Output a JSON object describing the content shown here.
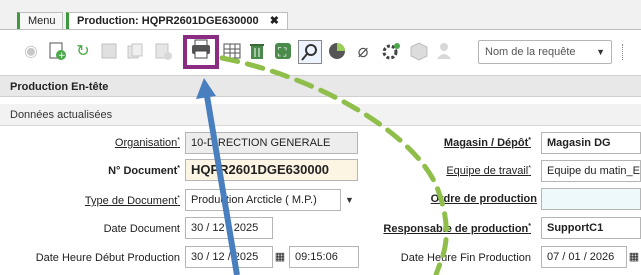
{
  "tabs": {
    "menu": "Menu",
    "active": "Production: HQPR2601DGE630000",
    "close": "✖"
  },
  "toolbar": {
    "request_placeholder": "Nom de la requête",
    "icons": [
      "refresh-icon",
      "new-record-icon",
      "undo-icon",
      "save-icon",
      "copy-icon",
      "delete-record-icon",
      "print-icon",
      "grid-icon",
      "trash-icon",
      "zoom-fit-icon",
      "search-zoom-icon",
      "chart-icon",
      "attachment-icon",
      "process-icon",
      "package-icon",
      "user-icon"
    ]
  },
  "section": {
    "title": "Production En-tête",
    "subtitle": "Données actualisées"
  },
  "form": {
    "organisation_label": "Organisation",
    "organisation_value": "10-DIRECTION GENERALE",
    "doc_label": "N° Document",
    "doc_value": "HQPR2601DGE630000",
    "type_label": "Type de Document",
    "type_value": "Production Arcticle ( M.P.)",
    "date_doc_label": "Date Document",
    "date_doc_value": "30 / 12 / 2025",
    "date_start_label": "Date Heure Début Production",
    "date_start_value": "30 / 12 / 2025",
    "time_start_value": "09:15:06",
    "magasin_label": "Magasin / Dépôt",
    "magasin_value": "Magasin DG",
    "equipe_label": "Equipe de travail",
    "equipe_value": "Equipe du matin_Eq",
    "ordre_label": "Ordre de production",
    "ordre_value": "",
    "resp_label": "Responsable de production",
    "resp_value": "SupportC1",
    "date_end_label": "Date Heure Fin Production",
    "date_end_value": "07 / 01 / 2026"
  },
  "colors": {
    "highlight": "#8a2d82",
    "arrow": "#4a7fbf",
    "dashed": "#8fbf4a"
  }
}
